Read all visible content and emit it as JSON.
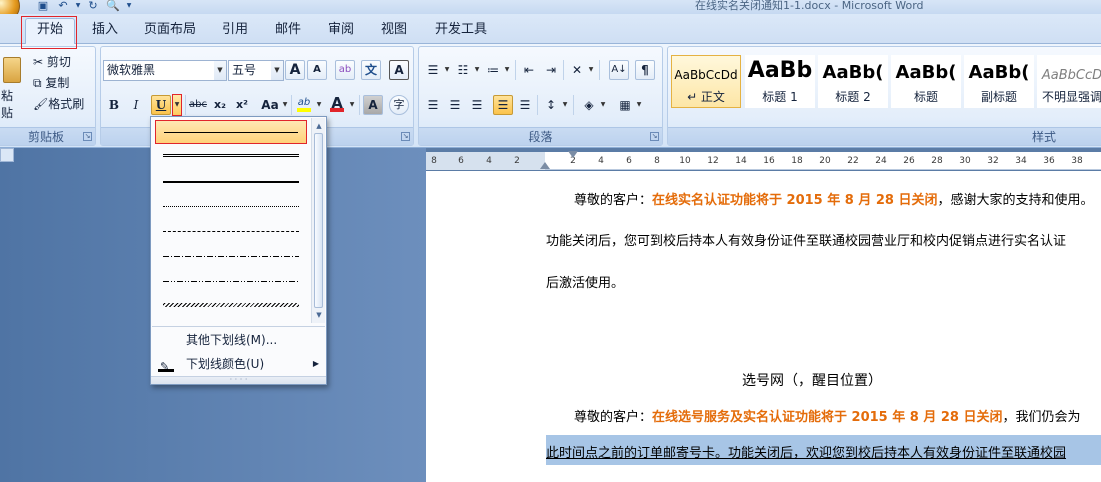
{
  "window": {
    "title": "在线实名关闭通知1-1.docx - Microsoft Word"
  },
  "qat": {
    "save_icon": "save-icon",
    "undo_icon": "undo-icon",
    "redo_icon": "redo-icon",
    "preview_icon": "print-preview-icon",
    "dropdown": "▼"
  },
  "tabs": [
    "开始",
    "插入",
    "页面布局",
    "引用",
    "邮件",
    "审阅",
    "视图",
    "开发工具"
  ],
  "clipboard": {
    "paste": "粘贴",
    "cut": "剪切",
    "copy": "复制",
    "format_painter": "格式刷",
    "group_label": "剪贴板"
  },
  "font": {
    "name": "微软雅黑",
    "size": "五号",
    "grow": "A",
    "shrink": "A",
    "clear": "ab",
    "phonetic": "文",
    "border": "A",
    "bold": "B",
    "italic": "I",
    "underline": "U",
    "strike": "abc",
    "subscript": "x₂",
    "superscript": "x²",
    "case": "Aa",
    "highlight": "ab",
    "color": "A",
    "shading": "A",
    "enclose": "字",
    "highlight_color": "#ffff00",
    "font_color": "#e1252b"
  },
  "paragraph": {
    "group_label": "段落",
    "show_marks": "¶"
  },
  "styles": {
    "group_label": "样式",
    "items": [
      {
        "sample": "AaBbCcDd",
        "name": "↵ 正文",
        "selected": true
      },
      {
        "sample": "AaBb",
        "name": "标题 1",
        "selected": false
      },
      {
        "sample": "AaBb(",
        "name": "标题 2",
        "selected": false
      },
      {
        "sample": "AaBb(",
        "name": "标题",
        "selected": false
      },
      {
        "sample": "AaBb(",
        "name": "副标题",
        "selected": false
      },
      {
        "sample": "AaBbCcD",
        "name": "不明显强调",
        "selected": false
      }
    ]
  },
  "ruler": {
    "ticks": [
      "8",
      "6",
      "4",
      "2",
      "2",
      "4",
      "6",
      "8",
      "10",
      "12",
      "14",
      "16",
      "18",
      "20",
      "22",
      "24",
      "26",
      "28",
      "30",
      "32",
      "34",
      "36",
      "38"
    ]
  },
  "underline_menu": {
    "more": "其他下划线(M)...",
    "color": "下划线颜色(U)",
    "more_mnemonic": "M",
    "color_mnemonic": "U"
  },
  "document": {
    "p1_prefix": "尊敬的客户：",
    "p1_orange": "在线实名认证功能将于 2015 年 8 月 28 日关闭",
    "p1_suffix": "，感谢大家的支持和使用。",
    "p2": "功能关闭后，您可到校后持本人有效身份证件至联通校园营业厅和校内促销点进行实名认证",
    "p3": "后激活使用。",
    "heading": "选号网（，醒目位置）",
    "p4_prefix": "尊敬的客户：",
    "p4_orange": "在线选号服务及实名认证功能将于 2015 年 8 月 28 日关闭",
    "p4_suffix": "，我们仍会为",
    "p5": "此时间点之前的订单邮寄号卡。功能关闭后，欢迎您到校后持本人有效身份证件至联通校园"
  }
}
